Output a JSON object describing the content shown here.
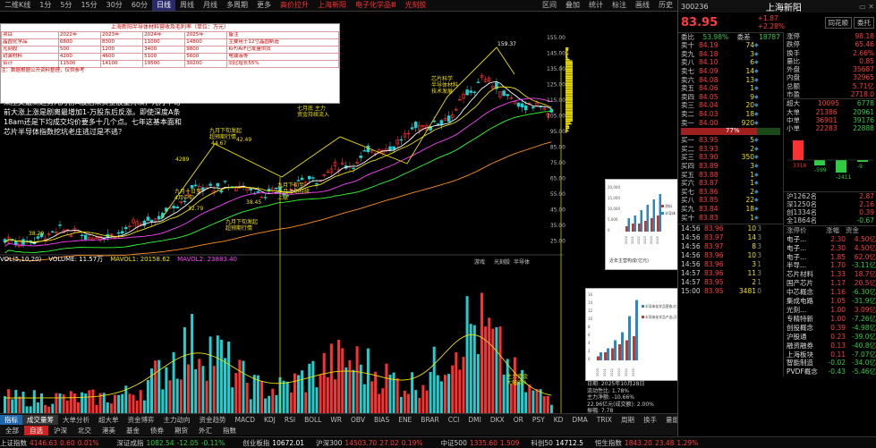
{
  "topbar": {
    "left_tabs": [
      "二维K线",
      "1分",
      "5分",
      "15分",
      "30分",
      "60分",
      "日线",
      "周线",
      "月线",
      "多周期",
      "更多"
    ],
    "active_tab": "日线",
    "highlight_tabs": [
      "高价拉升",
      "上海新阳",
      "电子化学品Ⅲ",
      "光刻胶"
    ],
    "right_tabs": [
      "区间",
      "叠加",
      "统计",
      "标注",
      "画线",
      "历史"
    ]
  },
  "chart": {
    "price_labels": [
      "155.00",
      "145.00",
      "135.00",
      "125.00",
      "115.00",
      "105.00",
      "95.00",
      "85.00",
      "75.00",
      "65.00",
      "55.00",
      "45.00",
      "35.00",
      "25.00"
    ],
    "high_label": "159.37",
    "annotations": [
      {
        "text": "44.67"
      },
      {
        "text": "4289"
      },
      {
        "text": "42.49"
      },
      {
        "text": "38.45"
      },
      {
        "text": "32.79"
      },
      {
        "text": "38.29"
      }
    ],
    "callouts": [
      "九月下旬发起\n超预期行情",
      "九月下旬发起\n超预期行情",
      "九月十日至\n4月中旬",
      "九月下旬至\n十月上旬持续\n上涨",
      "七月底 主力\n资金持续流入",
      "芯片科学\n半导体材料\n技术发展",
      "主力资金\n大幅流入"
    ],
    "subtitle_bar": [
      "VOL(5,10,20)",
      "VOLUME: 11.57万",
      "MAVOL1: 20158.62",
      "MAVOL2: 23883.40"
    ],
    "lower_tabs": [
      "游戏",
      "光刻胶",
      "半导体"
    ]
  },
  "info_table": {
    "title": "上海新阳半导体材料营收及毛利率（单位：万元）",
    "header": [
      "项目",
      "2022年",
      "2023年",
      "2024年",
      "2025年",
      "备注"
    ],
    "rows": [
      [
        "晶圆化学品",
        "6800",
        "8300",
        "11000",
        "14800",
        "主要用于12寸晶圆制造"
      ],
      [
        "光刻胶",
        "500",
        "1200",
        "3400",
        "9800",
        "KrF/ArF已批量供货"
      ],
      [
        "封装材料",
        "4200",
        "4600",
        "5100",
        "5600",
        "电镀液等"
      ],
      [
        "合计",
        "11500",
        "14100",
        "19500",
        "30200",
        "同比增长55%"
      ]
    ],
    "footer": "注：数据根据公开资料整理，仅供参考"
  },
  "annotation_text": "日线：芯片半导体大涨九月中旬那样刷新历史新高。七年来压文最新趋势九月份A股后来资金放量持续，元月中旬前大涨上涨是剧离最增加1-万股东后反涨。即使深度A条18am还是下均成交均价要多十几个点。七年这基本面和芯片半导体指数挖坑老庄逃过是不逃？",
  "popup1": {
    "title": "近年主营构成(亿元)",
    "legend": [
      "涂料",
      "半导体"
    ],
    "years": [
      "2020",
      "2021",
      "2022",
      "2023",
      "2024",
      "2025"
    ],
    "yaxis": [
      "20,000",
      "15,000",
      "10,000",
      "5,000",
      "0"
    ]
  },
  "popup2": {
    "legend": [
      "半导体化学品营收(亿元)",
      "半导体化学品产出(万吨)"
    ],
    "years": [
      "2020",
      "2021",
      "2022",
      "2023",
      "2024",
      "2025"
    ],
    "yaxis": [
      "16",
      "14",
      "12",
      "10",
      "8",
      "6",
      "4",
      "2",
      "0"
    ]
  },
  "mini_legend": {
    "date": "日期: 2025年10月28日",
    "lines": [
      "流动性比: 1.78%",
      "主力净额: -10.66%",
      "22.96亿元(成交额): 2.00%",
      "振幅: 7.78"
    ]
  },
  "indicator_tabs": [
    "指标",
    "成交量筹",
    "大单分析",
    "超大单",
    "资金博弈",
    "主力动向",
    "资金趋势",
    "MACD",
    "KDJ",
    "RSI",
    "BOLL",
    "WR",
    "OBV",
    "BIAS",
    "ENE",
    "BRAR",
    "CCI",
    "DMI",
    "DKX",
    "OR",
    "PSY",
    "KD",
    "DMA",
    "TRIX",
    "周期",
    "换手",
    "量能"
  ],
  "indicator_active": "成交量筹",
  "bottom_strip": [
    "全部",
    "自选",
    "沪深",
    "北交",
    "港美",
    "基金",
    "债券",
    "期货",
    "外汇",
    "指数"
  ],
  "bottom_active": "自选",
  "statusbar": {
    "items": [
      {
        "label": "上证指数",
        "value": "4146.63",
        "chg": "0.60",
        "pct": "0.01%",
        "color": "red"
      },
      {
        "label": "深证成指",
        "value": "1082.54",
        "chg": "-12.05",
        "pct": "-0.11%",
        "color": "green"
      },
      {
        "label": "创业板指",
        "value": "10672.01",
        "chg": "",
        "pct": "",
        "color": "white"
      },
      {
        "label": "沪深300",
        "value": "14503.70",
        "chg": "27.02",
        "pct": "0.19%",
        "color": "red"
      },
      {
        "label": "中证500",
        "value": "1335.60",
        "chg": "1.509",
        "pct": "",
        "color": "red"
      },
      {
        "label": "科创50",
        "value": "14712.5",
        "chg": "",
        "pct": "",
        "color": "white"
      },
      {
        "label": "恒生指数",
        "value": "1843.20",
        "chg": "23.48",
        "pct": "1.29%",
        "color": "red"
      }
    ]
  },
  "right_panel": {
    "code": "300236",
    "name": "上海新阳",
    "price": "83.95",
    "chg": "+1.87",
    "pct": "+2.28%",
    "tabs": [
      "同花顺",
      "委托"
    ],
    "weibi_label": "委比",
    "weibi": "53.98%",
    "weicha_label": "委差",
    "weicha": "18787",
    "sell_orders": [
      {
        "lvl": "卖十",
        "price": "84.19",
        "vol": "74"
      },
      {
        "lvl": "卖九",
        "price": "84.18",
        "vol": "3"
      },
      {
        "lvl": "卖八",
        "price": "84.10",
        "vol": "6"
      },
      {
        "lvl": "卖七",
        "price": "84.09",
        "vol": "14"
      },
      {
        "lvl": "卖六",
        "price": "84.08",
        "vol": "13"
      },
      {
        "lvl": "卖五",
        "price": "84.06",
        "vol": "1"
      },
      {
        "lvl": "卖四",
        "price": "84.05",
        "vol": "9"
      },
      {
        "lvl": "卖三",
        "price": "84.04",
        "vol": "20"
      },
      {
        "lvl": "卖二",
        "price": "84.03",
        "vol": "18"
      },
      {
        "lvl": "卖一",
        "price": "84.00",
        "vol": "920"
      }
    ],
    "buy_orders": [
      {
        "lvl": "买一",
        "price": "83.95",
        "vol": "5"
      },
      {
        "lvl": "买二",
        "price": "83.93",
        "vol": "2"
      },
      {
        "lvl": "买三",
        "price": "83.90",
        "vol": "350"
      },
      {
        "lvl": "买四",
        "price": "83.89",
        "vol": "3"
      },
      {
        "lvl": "买五",
        "price": "83.88",
        "vol": "1"
      },
      {
        "lvl": "买六",
        "price": "83.87",
        "vol": "1"
      },
      {
        "lvl": "买七",
        "price": "83.86",
        "vol": "2"
      },
      {
        "lvl": "买八",
        "price": "83.85",
        "vol": "22"
      },
      {
        "lvl": "买九",
        "price": "83.84",
        "vol": "18"
      },
      {
        "lvl": "买十",
        "price": "83.83",
        "vol": "1"
      }
    ],
    "mid_pct": "77%",
    "stats": [
      {
        "k": "涨停",
        "v": "98.18"
      },
      {
        "k": "跌停",
        "v": "65.46"
      },
      {
        "k": "换手",
        "v": "2.66%"
      },
      {
        "k": "量比",
        "v": "0.85"
      },
      {
        "k": "外盘",
        "v": "35687"
      },
      {
        "k": "内盘",
        "v": "32965"
      },
      {
        "k": "总额",
        "v": "5.71亿"
      },
      {
        "k": "市盈",
        "v": "2718.0"
      }
    ],
    "flow": [
      {
        "k": "超大",
        "in": "10095",
        "out": "6778"
      },
      {
        "k": "大单",
        "in": "21386",
        "out": "20961"
      },
      {
        "k": "中单",
        "in": "36901",
        "out": "39176"
      },
      {
        "k": "小单",
        "in": "22283",
        "out": "22888"
      }
    ],
    "bars_vals": [
      "3316",
      "-599",
      "-2411",
      "-9"
    ],
    "sectors": [
      {
        "name": "电子...",
        "a": "2.30",
        "b": "4.50亿"
      },
      {
        "name": "电子...",
        "a": "2.30",
        "b": "4.50亿"
      },
      {
        "name": "电子...",
        "a": "1.85",
        "b": "62.0亿"
      },
      {
        "name": "半导...",
        "a": "1.70",
        "b": "-3.11亿"
      },
      {
        "name": "芯片材料",
        "a": "1.33",
        "b": "18.7亿"
      },
      {
        "name": "国产芯片",
        "a": "1.17",
        "b": "20.5亿"
      },
      {
        "name": "中芯概念",
        "a": "1.16",
        "b": "-6.30亿"
      },
      {
        "name": "集成电路",
        "a": "1.05",
        "b": "-31.9亿"
      },
      {
        "name": "光刻...",
        "a": "1.00",
        "b": "3.09亿"
      },
      {
        "name": "专精特新",
        "a": "1.00",
        "b": "-7.26亿"
      },
      {
        "name": "创投概念",
        "a": "0.39",
        "b": "-4.98亿"
      },
      {
        "name": "沪股通",
        "a": "0.23",
        "b": "-39.0亿"
      },
      {
        "name": "融资融券",
        "a": "0.13",
        "b": "-40.8亿"
      },
      {
        "name": "上海板块",
        "a": "0.11",
        "b": "-7.07亿"
      },
      {
        "name": "智能制造",
        "a": "-0.02",
        "b": "-34.0亿"
      },
      {
        "name": "PVDF概念",
        "a": "-0.43",
        "b": "-5.46亿"
      }
    ],
    "sector_head": [
      "涨停价",
      "涨幅",
      "资金"
    ],
    "sector_rank": [
      {
        "k": "沪1262名",
        "v": "2.87"
      },
      {
        "k": "深1250名",
        "v": "2.16"
      },
      {
        "k": "创1334名",
        "v": "0.39"
      },
      {
        "k": "全1864名",
        "v": "-0.67"
      }
    ],
    "ticks": [
      {
        "t": "14:56",
        "p": "83.96",
        "v": "10",
        "d": "3"
      },
      {
        "t": "14:56",
        "p": "83.97",
        "v": "14",
        "d": "3"
      },
      {
        "t": "14:56",
        "p": "83.97",
        "v": "8",
        "d": "3"
      },
      {
        "t": "14:56",
        "p": "83.96",
        "v": "10",
        "d": "3"
      },
      {
        "t": "14:56",
        "p": "83.96",
        "v": "3",
        "d": "1"
      },
      {
        "t": "14:57",
        "p": "83.96",
        "v": "11",
        "d": "3"
      },
      {
        "t": "14:57",
        "p": "83.95",
        "v": "2",
        "d": "1"
      },
      {
        "t": "15:00",
        "p": "83.95",
        "v": "3481",
        "d": "0"
      }
    ]
  }
}
